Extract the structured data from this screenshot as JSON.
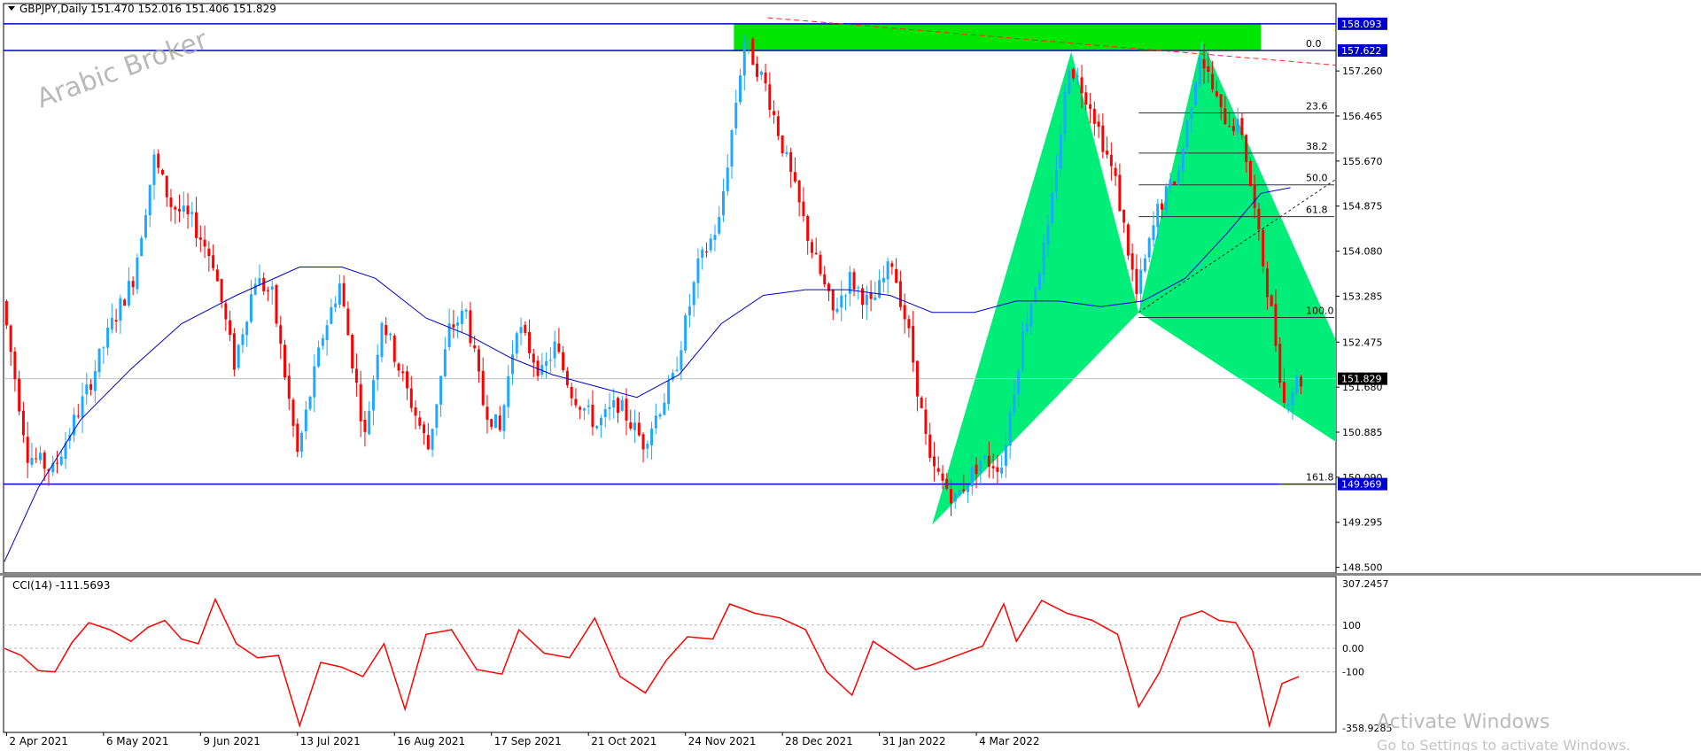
{
  "header": {
    "symbol": "GBPJPY,Daily",
    "ohlc": "151.470 152.016 151.406 151.829"
  },
  "watermark": "Arabic Broker",
  "os_notice": {
    "title": "Activate Windows",
    "subtitle": "Go to Settings to activate Windows."
  },
  "colors": {
    "bull": "#1fa8ff",
    "bear": "#ff0000",
    "ma": "#0000cc",
    "level_line": "#0000cc",
    "pattern_fill": "#00ee77",
    "zone_fill": "#00e600",
    "trend": "#ff2222",
    "cci": "#ff0000",
    "price_box": "#0000cc"
  },
  "chart_data": [
    {
      "type": "candlestick",
      "symbol": "GBPJPY",
      "timeframe": "Daily",
      "x_axis_labels": [
        "2 Apr 2021",
        "6 May 2021",
        "9 Jun 2021",
        "13 Jul 2021",
        "16 Aug 2021",
        "17 Sep 2021",
        "21 Oct 2021",
        "24 Nov 2021",
        "28 Dec 2021",
        "31 Jan 2022",
        "4 Mar 2022"
      ],
      "y_axis_labels": [
        "157.260",
        "156.465",
        "155.670",
        "154.875",
        "154.080",
        "153.285",
        "152.475",
        "151.680",
        "150.885",
        "150.090",
        "149.295",
        "148.500"
      ],
      "ylim": [
        148.4,
        158.45
      ],
      "current_price": "151.829",
      "price_line_value": 151.829,
      "horizontal_levels": [
        {
          "label": "158.093",
          "value": 158.093
        },
        {
          "label": "157.622",
          "value": 157.622
        },
        {
          "label": "149.969",
          "value": 149.969
        }
      ],
      "fibonacci": [
        {
          "label": "0.0",
          "value": 157.622
        },
        {
          "label": "23.6",
          "value": 156.52
        },
        {
          "label": "38.2",
          "value": 155.81
        },
        {
          "label": "50.0",
          "value": 155.25
        },
        {
          "label": "61.8",
          "value": 154.69
        },
        {
          "label": "100.0",
          "value": 152.91
        },
        {
          "label": "161.8",
          "value": 149.97
        }
      ],
      "price_path": [
        [
          0,
          153.2
        ],
        [
          6,
          150.5
        ],
        [
          12,
          150.2
        ],
        [
          20,
          151.6
        ],
        [
          26,
          152.8
        ],
        [
          31,
          153.6
        ],
        [
          36,
          155.7
        ],
        [
          40,
          154.9
        ],
        [
          45,
          154.6
        ],
        [
          50,
          153.9
        ],
        [
          55,
          152.1
        ],
        [
          60,
          153.6
        ],
        [
          64,
          153.3
        ],
        [
          70,
          150.5
        ],
        [
          76,
          152.6
        ],
        [
          80,
          153.5
        ],
        [
          86,
          150.8
        ],
        [
          90,
          152.9
        ],
        [
          96,
          151.6
        ],
        [
          101,
          150.6
        ],
        [
          106,
          152.7
        ],
        [
          110,
          153.0
        ],
        [
          114,
          151.4
        ],
        [
          118,
          150.9
        ],
        [
          122,
          152.8
        ],
        [
          128,
          151.9
        ],
        [
          131,
          152.4
        ],
        [
          135,
          151.6
        ],
        [
          141,
          151.0
        ],
        [
          146,
          151.4
        ],
        [
          152,
          150.7
        ],
        [
          159,
          151.8
        ],
        [
          165,
          153.8
        ],
        [
          170,
          154.6
        ],
        [
          176,
          157.8
        ],
        [
          181,
          157.0
        ],
        [
          187,
          155.4
        ],
        [
          192,
          154.1
        ],
        [
          197,
          153.0
        ],
        [
          201,
          153.6
        ],
        [
          206,
          153.1
        ],
        [
          211,
          153.9
        ],
        [
          215,
          152.6
        ],
        [
          220,
          150.3
        ],
        [
          226,
          149.7
        ],
        [
          232,
          150.4
        ],
        [
          237,
          150.3
        ],
        [
          242,
          152.6
        ],
        [
          248,
          154.4
        ],
        [
          253,
          157.4
        ],
        [
          258,
          156.7
        ],
        [
          264,
          155.3
        ],
        [
          269,
          153.3
        ],
        [
          274,
          154.8
        ],
        [
          279,
          155.5
        ],
        [
          284,
          157.6
        ],
        [
          289,
          156.5
        ],
        [
          294,
          156.2
        ],
        [
          298,
          154.3
        ],
        [
          301,
          153.0
        ],
        [
          304,
          151.4
        ],
        [
          307,
          151.8
        ]
      ],
      "ma_points": [
        [
          0,
          148.6
        ],
        [
          8,
          149.9
        ],
        [
          18,
          151.1
        ],
        [
          30,
          152.0
        ],
        [
          42,
          152.8
        ],
        [
          55,
          153.3
        ],
        [
          70,
          153.8
        ],
        [
          80,
          153.8
        ],
        [
          88,
          153.6
        ],
        [
          100,
          152.9
        ],
        [
          110,
          152.6
        ],
        [
          120,
          152.2
        ],
        [
          130,
          151.9
        ],
        [
          140,
          151.7
        ],
        [
          150,
          151.5
        ],
        [
          160,
          151.9
        ],
        [
          170,
          152.8
        ],
        [
          180,
          153.3
        ],
        [
          190,
          153.4
        ],
        [
          200,
          153.4
        ],
        [
          210,
          153.3
        ],
        [
          220,
          153.0
        ],
        [
          230,
          153.0
        ],
        [
          240,
          153.2
        ],
        [
          250,
          153.2
        ],
        [
          260,
          153.1
        ],
        [
          270,
          153.2
        ],
        [
          280,
          153.6
        ],
        [
          290,
          154.4
        ],
        [
          298,
          155.1
        ],
        [
          305,
          155.2
        ]
      ],
      "harmonic_pattern": {
        "leg1": [
          [
            220,
            149.25
          ],
          [
            253,
            157.6
          ],
          [
            269,
            153.0
          ]
        ],
        "leg2": [
          [
            269,
            153.0
          ],
          [
            284,
            157.8
          ],
          [
            331,
            149.97
          ]
        ]
      },
      "supply_zone": {
        "x0": 173,
        "x1": 298,
        "y_top": 158.093,
        "y_bottom": 157.622
      },
      "trendline": [
        [
          181,
          158.2
        ],
        [
          575,
          155.75
        ]
      ],
      "dotted_line": [
        [
          269,
          153.0
        ],
        [
          361,
          157.62
        ]
      ]
    },
    {
      "type": "line",
      "name": "CCI(14)",
      "title": "CCI(14) -111.5693",
      "y_axis_labels": [
        "307.2457",
        "100",
        "0.00",
        "-100",
        "-358.9285"
      ],
      "levels": [
        100,
        0,
        -100
      ],
      "ylim": [
        -358.9285,
        307.2457
      ],
      "values": [
        [
          0,
          0
        ],
        [
          4,
          -30
        ],
        [
          8,
          -95
        ],
        [
          12,
          -100
        ],
        [
          16,
          25
        ],
        [
          20,
          110
        ],
        [
          25,
          80
        ],
        [
          30,
          30
        ],
        [
          34,
          90
        ],
        [
          38,
          120
        ],
        [
          42,
          40
        ],
        [
          46,
          20
        ],
        [
          50,
          210
        ],
        [
          55,
          20
        ],
        [
          60,
          -40
        ],
        [
          65,
          -30
        ],
        [
          70,
          -330
        ],
        [
          75,
          -60
        ],
        [
          80,
          -80
        ],
        [
          85,
          -120
        ],
        [
          90,
          20
        ],
        [
          95,
          -260
        ],
        [
          100,
          60
        ],
        [
          106,
          80
        ],
        [
          112,
          -90
        ],
        [
          118,
          -110
        ],
        [
          122,
          80
        ],
        [
          128,
          -20
        ],
        [
          134,
          -40
        ],
        [
          140,
          130
        ],
        [
          146,
          -120
        ],
        [
          152,
          -190
        ],
        [
          157,
          -50
        ],
        [
          162,
          50
        ],
        [
          168,
          40
        ],
        [
          172,
          190
        ],
        [
          178,
          150
        ],
        [
          184,
          130
        ],
        [
          190,
          80
        ],
        [
          195,
          -100
        ],
        [
          201,
          -200
        ],
        [
          206,
          30
        ],
        [
          211,
          -30
        ],
        [
          216,
          -90
        ],
        [
          220,
          -70
        ],
        [
          226,
          -30
        ],
        [
          232,
          10
        ],
        [
          237,
          190
        ],
        [
          240,
          30
        ],
        [
          246,
          205
        ],
        [
          252,
          150
        ],
        [
          258,
          120
        ],
        [
          264,
          60
        ],
        [
          269,
          -250
        ],
        [
          274,
          -100
        ],
        [
          279,
          130
        ],
        [
          284,
          160
        ],
        [
          288,
          120
        ],
        [
          292,
          110
        ],
        [
          296,
          -10
        ],
        [
          300,
          -330
        ],
        [
          303,
          -150
        ],
        [
          307,
          -120
        ]
      ]
    }
  ]
}
